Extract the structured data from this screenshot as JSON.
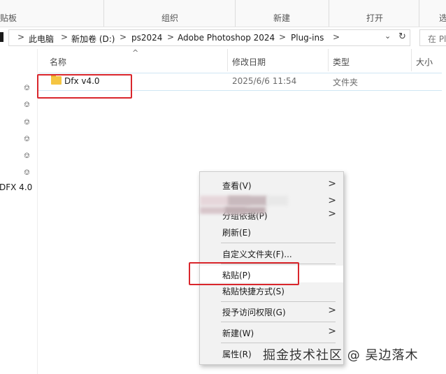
{
  "ribbon": {
    "groups": [
      "贴板",
      "组织",
      "新建",
      "打开",
      "选"
    ]
  },
  "address": {
    "crumbs": [
      "此电脑",
      "新加卷 (D:)",
      "ps2024",
      "Adobe Photoshop 2024",
      "Plug-ins"
    ],
    "sep": ">",
    "search_placeholder": "在 Pl"
  },
  "columns": {
    "name": "名称",
    "modified": "修改日期",
    "type": "类型",
    "size": "大小",
    "sort_indicator": "^"
  },
  "files": [
    {
      "name": "Dfx v4.0",
      "modified": "2025/6/6 11:54",
      "type": "文件夹"
    }
  ],
  "nav": {
    "truncated_item": "DFX 4.0"
  },
  "context_menu": {
    "items": [
      {
        "label": "查看(V)",
        "submenu": true
      },
      {
        "label": "分组依据(P)",
        "submenu": true
      },
      {
        "label": "刷新(E)",
        "submenu": false
      },
      {
        "label": "自定义文件夹(F)...",
        "submenu": false
      },
      {
        "label": "粘贴(P)",
        "submenu": false
      },
      {
        "label": "粘贴快捷方式(S)",
        "submenu": false
      },
      {
        "label": "授予访问权限(G)",
        "submenu": true
      },
      {
        "label": "新建(W)",
        "submenu": true
      },
      {
        "label": "属性(R)",
        "submenu": false
      }
    ],
    "arrow": ">"
  },
  "watermark": "掘金技术社区 @ 吴边落木",
  "colors": {
    "highlight_box": "#d9262c",
    "folder": "#f5c542",
    "menu_bg": "#f2f2f2"
  }
}
